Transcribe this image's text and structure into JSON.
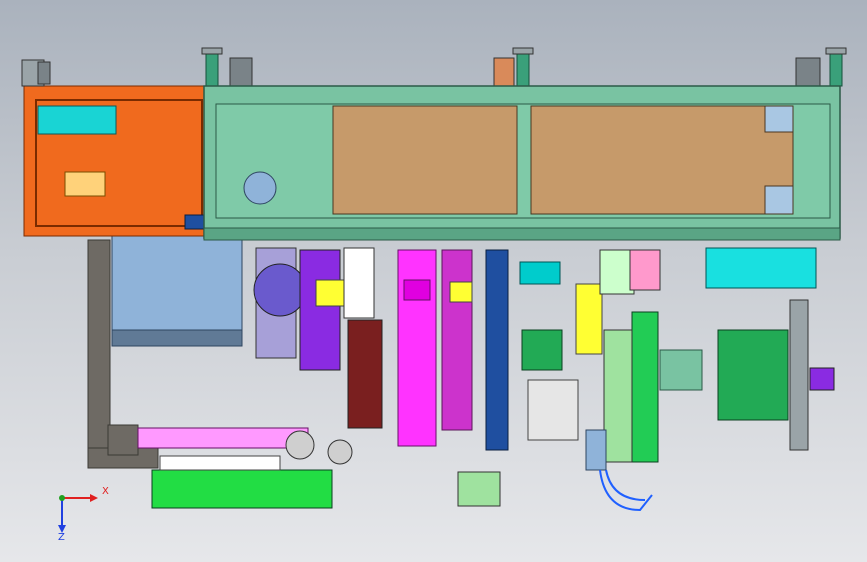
{
  "window": {
    "background_top": "#aab2bd",
    "background_bottom": "#e6e7ea"
  },
  "model": {
    "frame_color": "#79c3a2",
    "panel_color": "#c69a6a",
    "left_frame_color": "#f06a1e",
    "cabinet_color": "#8fb3d9",
    "base_color": "#6e6a64",
    "accent_colors": [
      "#ff33ff",
      "#cc33cc",
      "#8a2be2",
      "#ffff33",
      "#22cc55",
      "#00cccc",
      "#1f4fa0",
      "#7a1f1f"
    ]
  },
  "axis_triad": {
    "x_label": "X",
    "z_label": "Z",
    "x_color": "#e02020",
    "z_color": "#2040e0",
    "origin_color": "#20a020"
  }
}
